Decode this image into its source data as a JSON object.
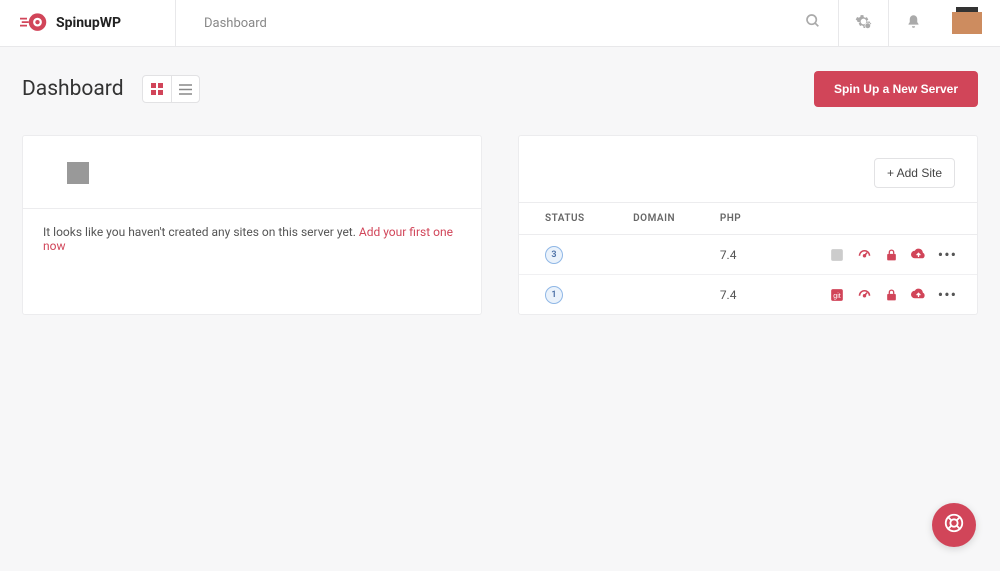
{
  "brand": {
    "name": "SpinupWP"
  },
  "breadcrumb": "Dashboard",
  "page_title": "Dashboard",
  "primary_action": "Spin Up a New Server",
  "card_empty": {
    "message": "It looks like you haven't created any sites on this server yet. ",
    "link_text": "Add your first one now"
  },
  "card_sites": {
    "add_site_label": "+ Add Site",
    "columns": {
      "status": "STATUS",
      "domain": "DOMAIN",
      "php": "PHP"
    },
    "rows": [
      {
        "status": "3",
        "domain": "",
        "php": "7.4",
        "git_muted": true
      },
      {
        "status": "1",
        "domain": "",
        "php": "7.4",
        "git_muted": false
      }
    ]
  }
}
